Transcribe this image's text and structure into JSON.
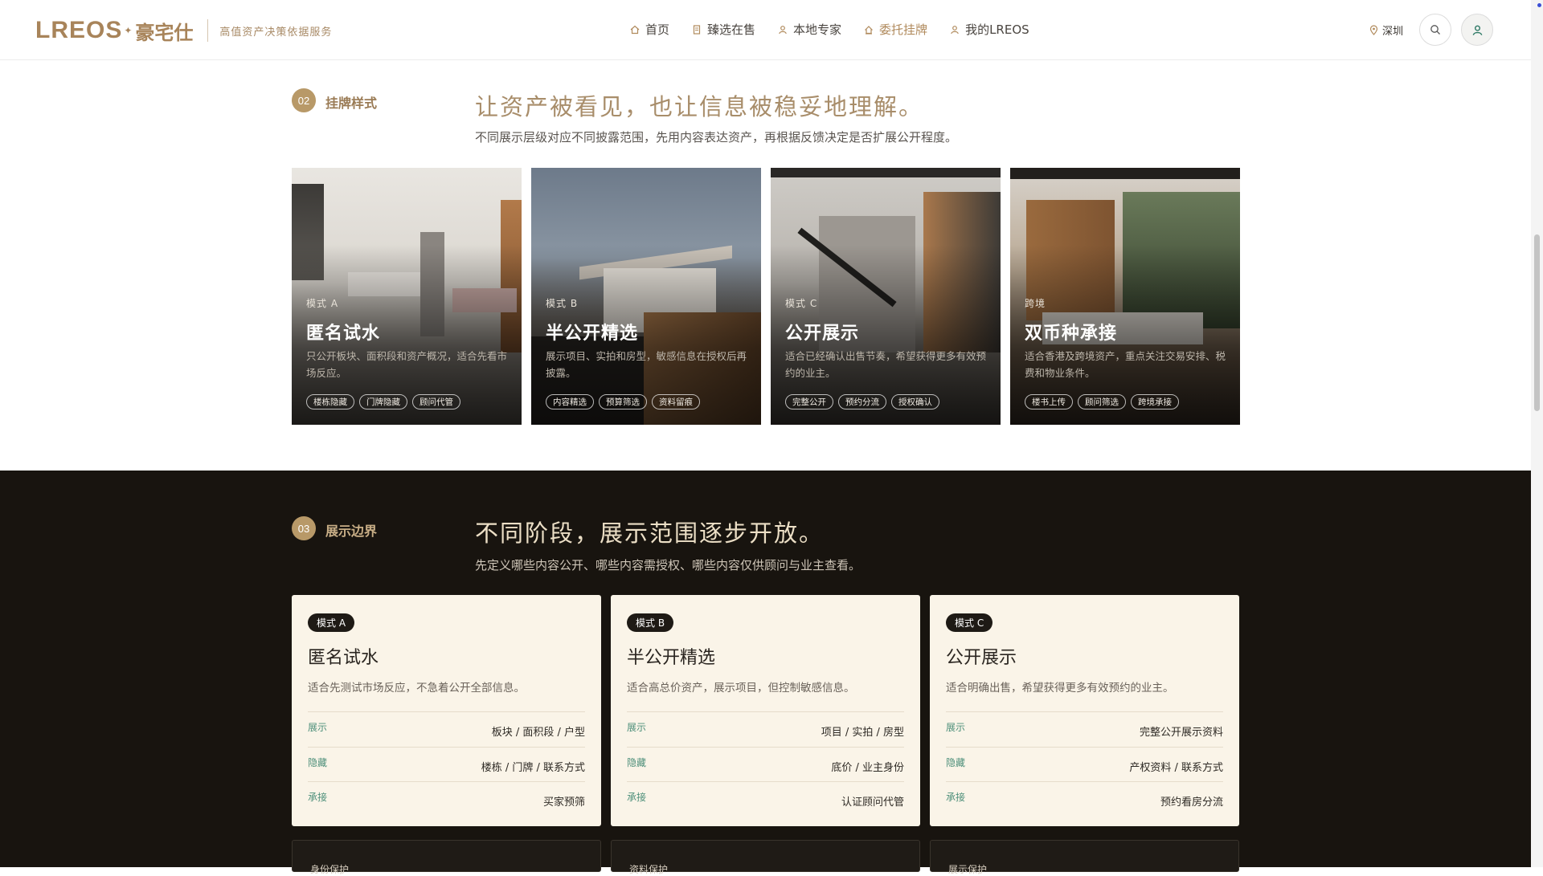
{
  "nav": {
    "logo_en": "LREOS",
    "logo_cn": "豪宅仕",
    "tagline": "高值资产决策依据服务",
    "menu": [
      {
        "label": "首页",
        "icon": "home-icon",
        "active": false
      },
      {
        "label": "臻选在售",
        "icon": "document-icon",
        "active": false
      },
      {
        "label": "本地专家",
        "icon": "person-icon",
        "active": false
      },
      {
        "label": "委托挂牌",
        "icon": "house-icon",
        "active": true
      },
      {
        "label": "我的LREOS",
        "icon": "user-icon",
        "active": false
      }
    ],
    "city": "深圳"
  },
  "section2": {
    "num": "02",
    "label": "挂牌样式",
    "title": "让资产被看见，也让信息被稳妥地理解。",
    "subtitle": "不同展示层级对应不同披露范围，先用内容表达资产，再根据反馈决定是否扩展公开程度。",
    "cards": [
      {
        "mode": "模式 A",
        "title": "匿名试水",
        "desc": "只公开板块、面积段和资产概况，适合先看市场反应。",
        "chips": [
          "楼栋隐藏",
          "门牌隐藏",
          "顾问代管"
        ]
      },
      {
        "mode": "模式 B",
        "title": "半公开精选",
        "desc": "展示项目、实拍和房型，敏感信息在授权后再披露。",
        "chips": [
          "内容精选",
          "预算筛选",
          "资料留痕"
        ]
      },
      {
        "mode": "模式 C",
        "title": "公开展示",
        "desc": "适合已经确认出售节奏，希望获得更多有效预约的业主。",
        "chips": [
          "完整公开",
          "预约分流",
          "授权确认"
        ]
      },
      {
        "mode": "跨境",
        "title": "双币种承接",
        "desc": "适合香港及跨境资产，重点关注交易安排、税费和物业条件。",
        "chips": [
          "楼书上传",
          "顾问筛选",
          "跨境承接"
        ]
      }
    ]
  },
  "section3": {
    "num": "03",
    "label": "展示边界",
    "title": "不同阶段，展示范围逐步开放。",
    "subtitle": "先定义哪些内容公开、哪些内容需授权、哪些内容仅供顾问与业主查看。",
    "cards": [
      {
        "tag": "模式 A",
        "title": "匿名试水",
        "desc": "适合先测试市场反应，不急着公开全部信息。",
        "rows": [
          {
            "k": "展示",
            "v": "板块 / 面积段 / 户型"
          },
          {
            "k": "隐藏",
            "v": "楼栋 / 门牌 / 联系方式"
          },
          {
            "k": "承接",
            "v": "买家预筛"
          }
        ]
      },
      {
        "tag": "模式 B",
        "title": "半公开精选",
        "desc": "适合高总价资产，展示项目，但控制敏感信息。",
        "rows": [
          {
            "k": "展示",
            "v": "项目 / 实拍 / 房型"
          },
          {
            "k": "隐藏",
            "v": "底价 / 业主身份"
          },
          {
            "k": "承接",
            "v": "认证顾问代管"
          }
        ]
      },
      {
        "tag": "模式 C",
        "title": "公开展示",
        "desc": "适合明确出售，希望获得更多有效预约的业主。",
        "rows": [
          {
            "k": "展示",
            "v": "完整公开展示资料"
          },
          {
            "k": "隐藏",
            "v": "产权资料 / 联系方式"
          },
          {
            "k": "承接",
            "v": "预约看房分流"
          }
        ]
      }
    ],
    "protect_cards": [
      "身份保护",
      "资料保护",
      "展示保护"
    ]
  }
}
